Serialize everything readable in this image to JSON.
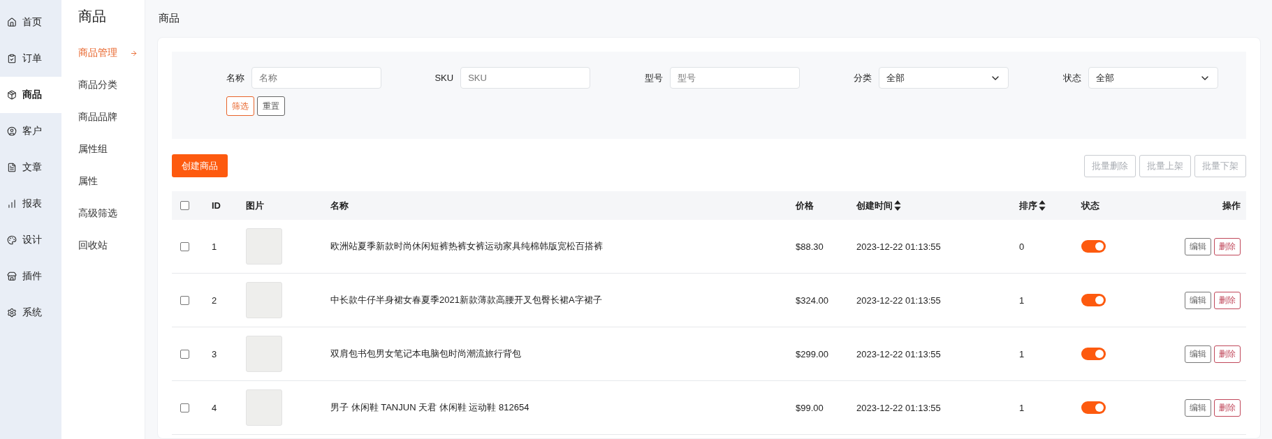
{
  "main_nav": [
    {
      "label": "首页",
      "selected": false
    },
    {
      "label": "订单",
      "selected": false
    },
    {
      "label": "商品",
      "selected": true
    },
    {
      "label": "客户",
      "selected": false
    },
    {
      "label": "文章",
      "selected": false
    },
    {
      "label": "报表",
      "selected": false
    },
    {
      "label": "设计",
      "selected": false
    },
    {
      "label": "插件",
      "selected": false
    },
    {
      "label": "系统",
      "selected": false
    }
  ],
  "sub_nav": {
    "title": "商品",
    "items": [
      {
        "label": "商品管理",
        "selected": true
      },
      {
        "label": "商品分类",
        "selected": false
      },
      {
        "label": "商品品牌",
        "selected": false
      },
      {
        "label": "属性组",
        "selected": false
      },
      {
        "label": "属性",
        "selected": false
      },
      {
        "label": "高级筛选",
        "selected": false
      },
      {
        "label": "回收站",
        "selected": false
      }
    ]
  },
  "page_title": "商品",
  "filters": [
    {
      "kind": "text",
      "label": "名称",
      "placeholder": "名称"
    },
    {
      "kind": "text",
      "label": "SKU",
      "placeholder": "SKU"
    },
    {
      "kind": "text",
      "label": "型号",
      "placeholder": "型号"
    },
    {
      "kind": "select",
      "label": "分类",
      "value": "全部"
    },
    {
      "kind": "select",
      "label": "状态",
      "value": "全部"
    }
  ],
  "filter_buttons": [
    {
      "kind": "primary",
      "label": "筛选"
    },
    {
      "kind": "default",
      "label": "重置"
    }
  ],
  "create_button": "创建商品",
  "bulk_buttons": [
    {
      "label": "批量删除",
      "disabled": true
    },
    {
      "label": "批量上架",
      "disabled": true
    },
    {
      "label": "批量下架",
      "disabled": true
    }
  ],
  "table": {
    "select_all_checked": false,
    "columns": [
      {
        "label": "ID",
        "sortable": false
      },
      {
        "label": "图片",
        "sortable": false
      },
      {
        "label": "名称",
        "sortable": false
      },
      {
        "label": "价格",
        "sortable": false
      },
      {
        "label": "创建时间",
        "sortable": true
      },
      {
        "label": "排序",
        "sortable": true
      },
      {
        "label": "状态",
        "sortable": false
      },
      {
        "label": "操作",
        "sortable": false
      }
    ],
    "rows": [
      {
        "checked": false,
        "id": "1",
        "name": "欧洲站夏季新款时尚休闲短裤热裤女裤运动家具纯棉韩版宽松百搭裤",
        "price": "$88.30",
        "created": "2023-12-22 01:13:55",
        "sort": "0",
        "on": true,
        "actions": [
          "编辑",
          "删除"
        ]
      },
      {
        "checked": false,
        "id": "2",
        "name": "中长款牛仔半身裙女春夏季2021新款薄款高腰开叉包臀长裙A字裙子",
        "price": "$324.00",
        "created": "2023-12-22 01:13:55",
        "sort": "1",
        "on": true,
        "actions": [
          "编辑",
          "删除"
        ]
      },
      {
        "checked": false,
        "id": "3",
        "name": "双肩包书包男女笔记本电脑包时尚潮流旅行背包",
        "price": "$299.00",
        "created": "2023-12-22 01:13:55",
        "sort": "1",
        "on": true,
        "actions": [
          "编辑",
          "删除"
        ]
      },
      {
        "checked": false,
        "id": "4",
        "name": "男子 休闲鞋 TANJUN 天君 休闲鞋 运动鞋 812654",
        "price": "$99.00",
        "created": "2023-12-22 01:13:55",
        "sort": "1",
        "on": true,
        "actions": [
          "编辑",
          "删除"
        ]
      }
    ]
  }
}
